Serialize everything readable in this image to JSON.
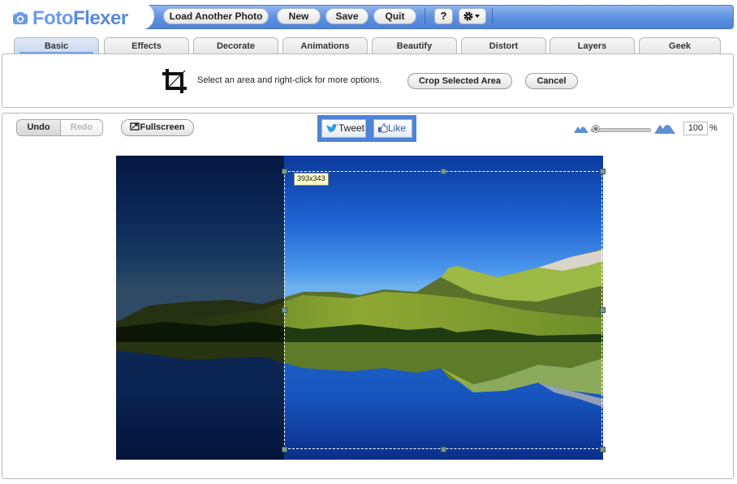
{
  "app": {
    "logo_text_a": "Foto",
    "logo_text_b": "Flexer"
  },
  "toolbar": {
    "load_label": "Load Another Photo",
    "new_label": "New",
    "save_label": "Save",
    "quit_label": "Quit",
    "help_label": "?",
    "settings_icon": "gear-icon"
  },
  "tabs": [
    "Basic",
    "Effects",
    "Decorate",
    "Animations",
    "Beautify",
    "Distort",
    "Layers",
    "Geek"
  ],
  "active_tab": "Basic",
  "crop": {
    "icon": "crop-icon",
    "instruction": "Select an area and right-click for more options.",
    "crop_label": "Crop Selected Area",
    "cancel_label": "Cancel"
  },
  "workspace": {
    "undo_label": "Undo",
    "redo_label": "Redo",
    "fullscreen_label": "Fullscreen",
    "tweet_label": "Tweet",
    "like_label": "Like",
    "zoom_value": "100",
    "zoom_unit": "%",
    "zoom_level": 0.05,
    "selection_size": "393x343"
  },
  "colors": {
    "toolbar_blue": "#5b8fe0",
    "social_blue": "#4d83d8",
    "logo_blue": "#6a9be6"
  }
}
